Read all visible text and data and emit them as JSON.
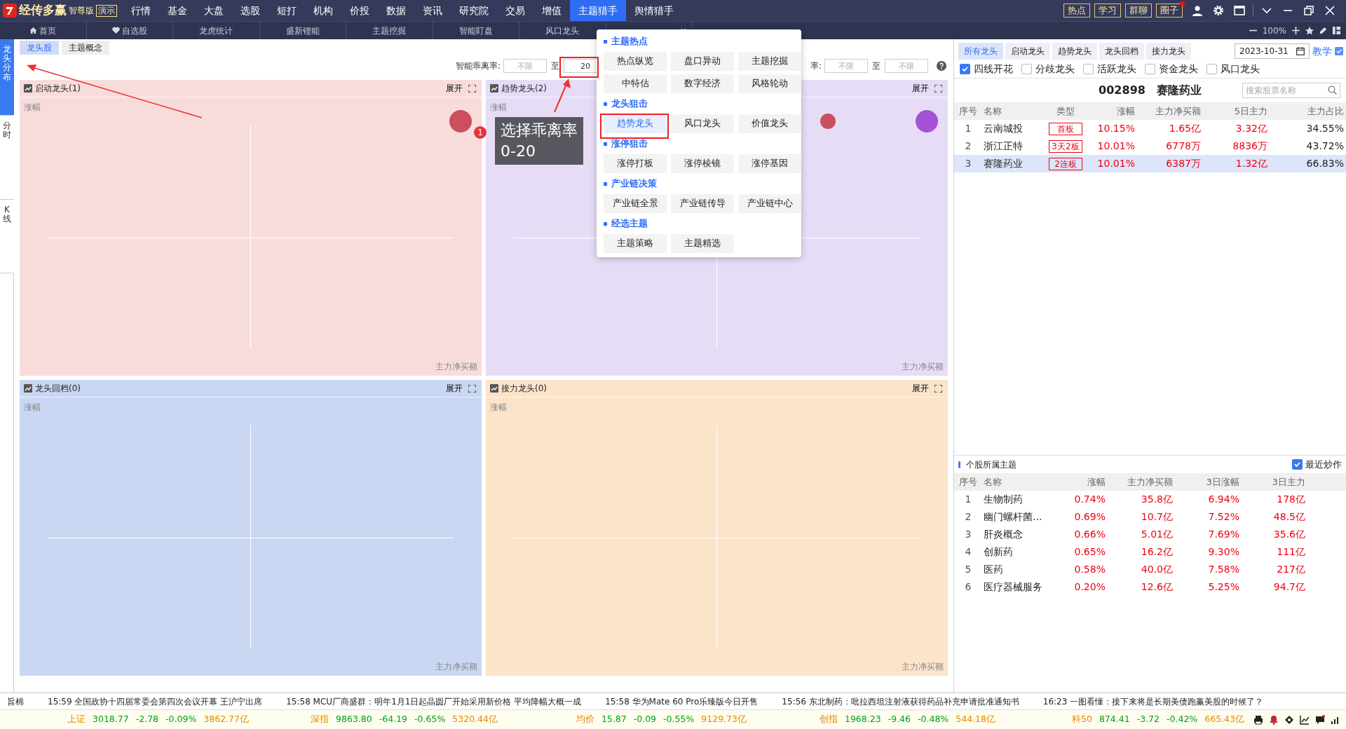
{
  "app": {
    "logo": "经传多赢",
    "edition": "智尊版",
    "demo": "演示"
  },
  "menu": [
    {
      "label": "行情",
      "selected": false
    },
    {
      "label": "基金",
      "selected": false
    },
    {
      "label": "大盘",
      "selected": false
    },
    {
      "label": "选股",
      "selected": false
    },
    {
      "label": "短打",
      "selected": false
    },
    {
      "label": "机构",
      "selected": false
    },
    {
      "label": "价投",
      "selected": false
    },
    {
      "label": "数据",
      "selected": false
    },
    {
      "label": "资讯",
      "selected": false
    },
    {
      "label": "研究院",
      "selected": false
    },
    {
      "label": "交易",
      "selected": false
    },
    {
      "label": "增值",
      "selected": false
    },
    {
      "label": "主题猎手",
      "selected": true
    },
    {
      "label": "舆情猎手",
      "selected": false
    }
  ],
  "top_buttons": [
    {
      "label": "热点",
      "notification": false
    },
    {
      "label": "学习",
      "notification": false
    },
    {
      "label": "群聊",
      "notification": false
    },
    {
      "label": "圈子",
      "notification": true
    }
  ],
  "tabs": [
    {
      "kind": "home",
      "label": "首页"
    },
    {
      "kind": "favorite",
      "label": "自选股"
    },
    {
      "kind": "plain",
      "label": "龙虎统计"
    },
    {
      "kind": "plain",
      "label": "盛新锂能"
    },
    {
      "kind": "plain",
      "label": "主题挖掘"
    },
    {
      "kind": "plain",
      "label": "智能盯盘"
    },
    {
      "kind": "plain",
      "label": "风口龙头"
    },
    {
      "kind": "closable"
    }
  ],
  "zoom": {
    "value": "100%"
  },
  "side_tabs": [
    {
      "label": "龙头分布",
      "selected": true
    },
    {
      "label": "分时",
      "selected": false
    },
    {
      "label": "K线",
      "selected": false
    }
  ],
  "sub_tabs": [
    {
      "label": "龙头股",
      "selected": true
    },
    {
      "label": "主题概念",
      "selected": false
    }
  ],
  "filters": [
    {
      "label": "智能乖离率:",
      "from": {
        "placeholder": "不限"
      },
      "to_label": "至",
      "to": {
        "value": "20"
      }
    },
    {
      "label": "率:",
      "from": {
        "placeholder": "不限"
      },
      "to_label": "至",
      "to": {
        "placeholder": "不限"
      }
    }
  ],
  "panels": [
    {
      "title": "启动龙头(1)",
      "expand": "展开",
      "y_label": "涨幅",
      "x_label": "主力净买额",
      "color": "#f8dcdc",
      "bubbles": [
        {
          "color": "#c9505c"
        }
      ]
    },
    {
      "title": "趋势龙头(2)",
      "expand": "展开",
      "y_label": "涨幅",
      "x_label": "主力净买额",
      "color": "#e7dcf6",
      "bubbles": [
        {
          "color": "#c9505c"
        },
        {
          "color": "#a452d6"
        }
      ]
    },
    {
      "title": "龙头回档(0)",
      "expand": "展开",
      "y_label": "涨幅",
      "x_label": "主力净买额",
      "color": "#c9d7f2"
    },
    {
      "title": "接力龙头(0)",
      "expand": "展开",
      "y_label": "涨幅",
      "x_label": "主力净买额",
      "color": "#fbe4ca"
    }
  ],
  "dropdown": {
    "sections": [
      {
        "title": "主题热点",
        "items": [
          {
            "label": "热点纵览",
            "selected": false
          },
          {
            "label": "盘口异动",
            "selected": false
          },
          {
            "label": "主题挖掘",
            "selected": false
          },
          {
            "label": "中特估",
            "selected": false
          },
          {
            "label": "数字经济",
            "selected": false
          },
          {
            "label": "风格轮动",
            "selected": false
          }
        ]
      },
      {
        "title": "龙头狙击",
        "items": [
          {
            "label": "趋势龙头",
            "selected": true
          },
          {
            "label": "风口龙头",
            "selected": false
          },
          {
            "label": "价值龙头",
            "selected": false
          }
        ]
      },
      {
        "title": "涨停狙击",
        "items": [
          {
            "label": "涨停打板",
            "selected": false
          },
          {
            "label": "涨停棱镜",
            "selected": false
          },
          {
            "label": "涨停基因",
            "selected": false
          }
        ]
      },
      {
        "title": "产业链决策",
        "items": [
          {
            "label": "产业链全景",
            "selected": false
          },
          {
            "label": "产业链传导",
            "selected": false
          },
          {
            "label": "产业链中心",
            "selected": false
          }
        ]
      },
      {
        "title": "经选主题",
        "items": [
          {
            "label": "主题策略",
            "selected": false
          },
          {
            "label": "主题精选",
            "selected": false
          }
        ]
      }
    ]
  },
  "annotation": {
    "badge": "1",
    "text": "选择乖离率 0-20"
  },
  "right": {
    "tabs": [
      {
        "label": "所有龙头",
        "selected": true
      },
      {
        "label": "启动龙头",
        "selected": false
      },
      {
        "label": "趋势龙头",
        "selected": false
      },
      {
        "label": "龙头回档",
        "selected": false
      },
      {
        "label": "接力龙头",
        "selected": false
      }
    ],
    "date": "2023-10-31",
    "help": "教学",
    "checks": [
      {
        "label": "四线开花",
        "checked": true
      },
      {
        "label": "分歧龙头",
        "checked": false
      },
      {
        "label": "活跃龙头",
        "checked": false
      },
      {
        "label": "资金龙头",
        "checked": false
      },
      {
        "label": "风口龙头",
        "checked": false
      }
    ],
    "stock": {
      "code": "002898",
      "name": "赛隆药业"
    },
    "search": {
      "placeholder": "搜索股票名称"
    },
    "table": {
      "columns": [
        "序号",
        "名称",
        "类型",
        "涨幅",
        "主力净买额",
        "5日主力",
        "主力占比"
      ],
      "rows": [
        {
          "cells": [
            "1",
            "云南城投",
            "首板",
            "10.15%",
            "1.65亿",
            "3.32亿",
            "34.55%"
          ],
          "selected": false
        },
        {
          "cells": [
            "2",
            "浙江正特",
            "3天2板",
            "10.01%",
            "6778万",
            "8836万",
            "43.72%"
          ],
          "selected": false
        },
        {
          "cells": [
            "3",
            "赛隆药业",
            "2连板",
            "10.01%",
            "6387万",
            "1.32亿",
            "66.83%"
          ],
          "selected": true
        }
      ]
    }
  },
  "themes": {
    "title": "个股所属主题",
    "recent": {
      "label": "最近炒作",
      "checked": true
    },
    "columns": [
      "序号",
      "名称",
      "涨幅",
      "主力净买额",
      "3日涨幅",
      "3日主力"
    ],
    "rows": [
      [
        "1",
        "生物制药",
        "0.74%",
        "35.8亿",
        "6.94%",
        "178亿"
      ],
      [
        "2",
        "幽门螺杆菌...",
        "0.69%",
        "10.7亿",
        "7.52%",
        "48.5亿"
      ],
      [
        "3",
        "肝炎概念",
        "0.66%",
        "5.01亿",
        "7.69%",
        "35.6亿"
      ],
      [
        "4",
        "创新药",
        "0.65%",
        "16.2亿",
        "9.30%",
        "111亿"
      ],
      [
        "5",
        "医药",
        "0.58%",
        "40.0亿",
        "7.58%",
        "217亿"
      ],
      [
        "6",
        "医疗器械服务",
        "0.20%",
        "12.6亿",
        "5.25%",
        "94.7亿"
      ]
    ]
  },
  "ticker": {
    "label": "旨棉",
    "news": [
      "15:59 全国政协十四届常委会第四次会议开幕 王沪宁出席",
      "15:58 MCU厂商盛群：明年1月1日起晶圆厂开始采用新价格 平均降幅大概一成",
      "15:58 华为Mate 60 Pro乐臻版今日开售",
      "15:56 东北制药：吡拉西坦注射液获得药品补充申请批准通知书",
      "16:23 一图看懂：接下来将是长期美债跑赢美股的时候了？"
    ]
  },
  "indices": [
    {
      "name": "上证",
      "price": "3018.77",
      "change": "-2.78",
      "pct": "-0.09%",
      "amount": "3862.77亿"
    },
    {
      "name": "深指",
      "price": "9863.80",
      "change": "-64.19",
      "pct": "-0.65%",
      "amount": "5320.44亿"
    },
    {
      "name": "均价",
      "price": "15.87",
      "change": "-0.09",
      "pct": "-0.55%",
      "amount": "9129.73亿"
    },
    {
      "name": "创指",
      "price": "1968.23",
      "change": "-9.46",
      "pct": "-0.48%",
      "amount": "544.18亿"
    },
    {
      "name": "科50",
      "price": "874.41",
      "change": "-3.72",
      "pct": "-0.42%",
      "amount": "665.43亿"
    }
  ]
}
